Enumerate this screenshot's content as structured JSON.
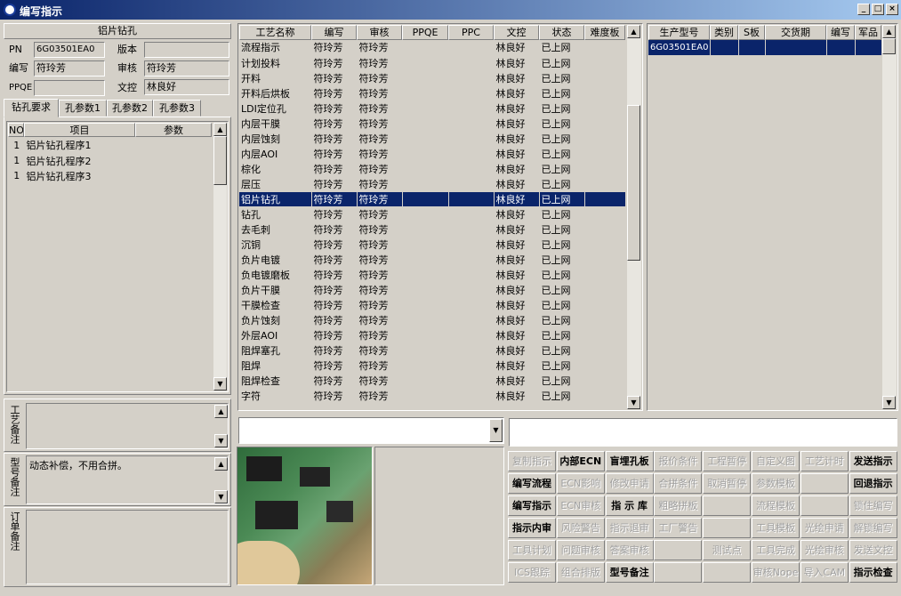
{
  "window": {
    "title": "编写指示",
    "minimize": "_",
    "restore": "□",
    "close": "×"
  },
  "left": {
    "header": "铝片钻孔",
    "pn_label": "PN",
    "pn_value": "6G03501EA0",
    "version_label": "版本",
    "version_value": "",
    "author_label": "编写",
    "author_value": "符玲芳",
    "reviewer_label": "审核",
    "reviewer_value": "符玲芳",
    "ppqe_label": "PPQE",
    "ppqe_value": "",
    "dc_label": "文控",
    "dc_value": "林良好",
    "tabs": [
      "钻孔要求",
      "孔参数1",
      "孔参数2",
      "孔参数3"
    ],
    "table_headers": [
      "NO",
      "项目",
      "参数"
    ],
    "rows": [
      [
        "1",
        "铝片钻孔程序1",
        ""
      ],
      [
        "1",
        "铝片钻孔程序2",
        ""
      ],
      [
        "1",
        "铝片钻孔程序3",
        ""
      ]
    ],
    "process_note_label": "工艺备注",
    "process_note": "",
    "model_note_label": "型号备注",
    "model_note": "动态补偿，不用合拼。",
    "order_note_label": "订单备注",
    "order_note": ""
  },
  "middle": {
    "headers": [
      "工艺名称",
      "编写",
      "审核",
      "PPQE",
      "PPC",
      "文控",
      "状态",
      "难度板"
    ],
    "rows": [
      [
        "流程指示",
        "符玲芳",
        "符玲芳",
        "",
        "",
        "林良好",
        "已上网",
        ""
      ],
      [
        "计划投料",
        "符玲芳",
        "符玲芳",
        "",
        "",
        "林良好",
        "已上网",
        ""
      ],
      [
        "开料",
        "符玲芳",
        "符玲芳",
        "",
        "",
        "林良好",
        "已上网",
        ""
      ],
      [
        "开料后烘板",
        "符玲芳",
        "符玲芳",
        "",
        "",
        "林良好",
        "已上网",
        ""
      ],
      [
        "LDI定位孔",
        "符玲芳",
        "符玲芳",
        "",
        "",
        "林良好",
        "已上网",
        ""
      ],
      [
        "内层干膜",
        "符玲芳",
        "符玲芳",
        "",
        "",
        "林良好",
        "已上网",
        ""
      ],
      [
        "内层蚀刻",
        "符玲芳",
        "符玲芳",
        "",
        "",
        "林良好",
        "已上网",
        ""
      ],
      [
        "内层AOI",
        "符玲芳",
        "符玲芳",
        "",
        "",
        "林良好",
        "已上网",
        ""
      ],
      [
        "棕化",
        "符玲芳",
        "符玲芳",
        "",
        "",
        "林良好",
        "已上网",
        ""
      ],
      [
        "层压",
        "符玲芳",
        "符玲芳",
        "",
        "",
        "林良好",
        "已上网",
        ""
      ],
      [
        "铝片钻孔",
        "符玲芳",
        "符玲芳",
        "",
        "",
        "林良好",
        "已上网",
        ""
      ],
      [
        "钻孔",
        "符玲芳",
        "符玲芳",
        "",
        "",
        "林良好",
        "已上网",
        ""
      ],
      [
        "去毛刺",
        "符玲芳",
        "符玲芳",
        "",
        "",
        "林良好",
        "已上网",
        ""
      ],
      [
        "沉铜",
        "符玲芳",
        "符玲芳",
        "",
        "",
        "林良好",
        "已上网",
        ""
      ],
      [
        "负片电镀",
        "符玲芳",
        "符玲芳",
        "",
        "",
        "林良好",
        "已上网",
        ""
      ],
      [
        "负电镀磨板",
        "符玲芳",
        "符玲芳",
        "",
        "",
        "林良好",
        "已上网",
        ""
      ],
      [
        "负片干膜",
        "符玲芳",
        "符玲芳",
        "",
        "",
        "林良好",
        "已上网",
        ""
      ],
      [
        "干膜检查",
        "符玲芳",
        "符玲芳",
        "",
        "",
        "林良好",
        "已上网",
        ""
      ],
      [
        "负片蚀刻",
        "符玲芳",
        "符玲芳",
        "",
        "",
        "林良好",
        "已上网",
        ""
      ],
      [
        "外层AOI",
        "符玲芳",
        "符玲芳",
        "",
        "",
        "林良好",
        "已上网",
        ""
      ],
      [
        "阻焊塞孔",
        "符玲芳",
        "符玲芳",
        "",
        "",
        "林良好",
        "已上网",
        ""
      ],
      [
        "阻焊",
        "符玲芳",
        "符玲芳",
        "",
        "",
        "林良好",
        "已上网",
        ""
      ],
      [
        "阻焊检查",
        "符玲芳",
        "符玲芳",
        "",
        "",
        "林良好",
        "已上网",
        ""
      ],
      [
        "字符",
        "符玲芳",
        "符玲芳",
        "",
        "",
        "林良好",
        "已上网",
        ""
      ]
    ],
    "selected_index": 10,
    "combo_value": ""
  },
  "right": {
    "headers": [
      "生产型号",
      "类别",
      "S板",
      "交货期",
      "编写",
      "军品"
    ],
    "rows": [
      [
        "6G03501EA0",
        "",
        "",
        "",
        "",
        ""
      ]
    ],
    "input_value": ""
  },
  "buttons": [
    [
      {
        "t": "复制指示",
        "d": true
      },
      {
        "t": "内部ECN",
        "d": false,
        "b": true
      },
      {
        "t": "盲埋孔板",
        "d": false,
        "b": true
      },
      {
        "t": "报价条件",
        "d": true
      },
      {
        "t": "工程暂停",
        "d": true
      },
      {
        "t": "自定义图",
        "d": true
      },
      {
        "t": "工艺计时",
        "d": true
      },
      {
        "t": "发送指示",
        "d": false,
        "b": true
      }
    ],
    [
      {
        "t": "编写流程",
        "d": false,
        "b": true
      },
      {
        "t": "ECN影响",
        "d": true
      },
      {
        "t": "修改申请",
        "d": true
      },
      {
        "t": "合拼条件",
        "d": true
      },
      {
        "t": "取消暂停",
        "d": true
      },
      {
        "t": "参数模板",
        "d": true
      },
      {
        "t": "",
        "d": true
      },
      {
        "t": "回退指示",
        "d": false,
        "b": true
      }
    ],
    [
      {
        "t": "编写指示",
        "d": false,
        "b": true
      },
      {
        "t": "ECN审核",
        "d": true
      },
      {
        "t": "指 示 库",
        "d": false,
        "b": true
      },
      {
        "t": "粗略拼板",
        "d": true
      },
      {
        "t": "",
        "d": true
      },
      {
        "t": "流程模板",
        "d": true
      },
      {
        "t": "",
        "d": true
      },
      {
        "t": "锁住编写",
        "d": true
      }
    ],
    [
      {
        "t": "指示内审",
        "d": false,
        "b": true
      },
      {
        "t": "风险警告",
        "d": true
      },
      {
        "t": "指示退审",
        "d": true
      },
      {
        "t": "工厂警告",
        "d": true
      },
      {
        "t": "",
        "d": true
      },
      {
        "t": "工具模板",
        "d": true
      },
      {
        "t": "光绘申请",
        "d": true
      },
      {
        "t": "解锁编写",
        "d": true
      }
    ],
    [
      {
        "t": "工具计划",
        "d": true
      },
      {
        "t": "问题审核",
        "d": true
      },
      {
        "t": "答案审核",
        "d": true
      },
      {
        "t": "",
        "d": true
      },
      {
        "t": "测试点",
        "d": true
      },
      {
        "t": "工具完成",
        "d": true
      },
      {
        "t": "光绘审核",
        "d": true
      },
      {
        "t": "发送文控",
        "d": true
      }
    ],
    [
      {
        "t": "ICS跟踪",
        "d": true
      },
      {
        "t": "组合排版",
        "d": true
      },
      {
        "t": "型号备注",
        "d": false,
        "b": true
      },
      {
        "t": "",
        "d": true
      },
      {
        "t": "",
        "d": true
      },
      {
        "t": "审核Nope",
        "d": true
      },
      {
        "t": "导入CAM",
        "d": true
      },
      {
        "t": "指示检查",
        "d": false,
        "b": true
      }
    ]
  ],
  "colors": {
    "title_start": "#0a246a",
    "title_end": "#a6caf0",
    "selection": "#0a246a",
    "face": "#d4d0c8"
  }
}
